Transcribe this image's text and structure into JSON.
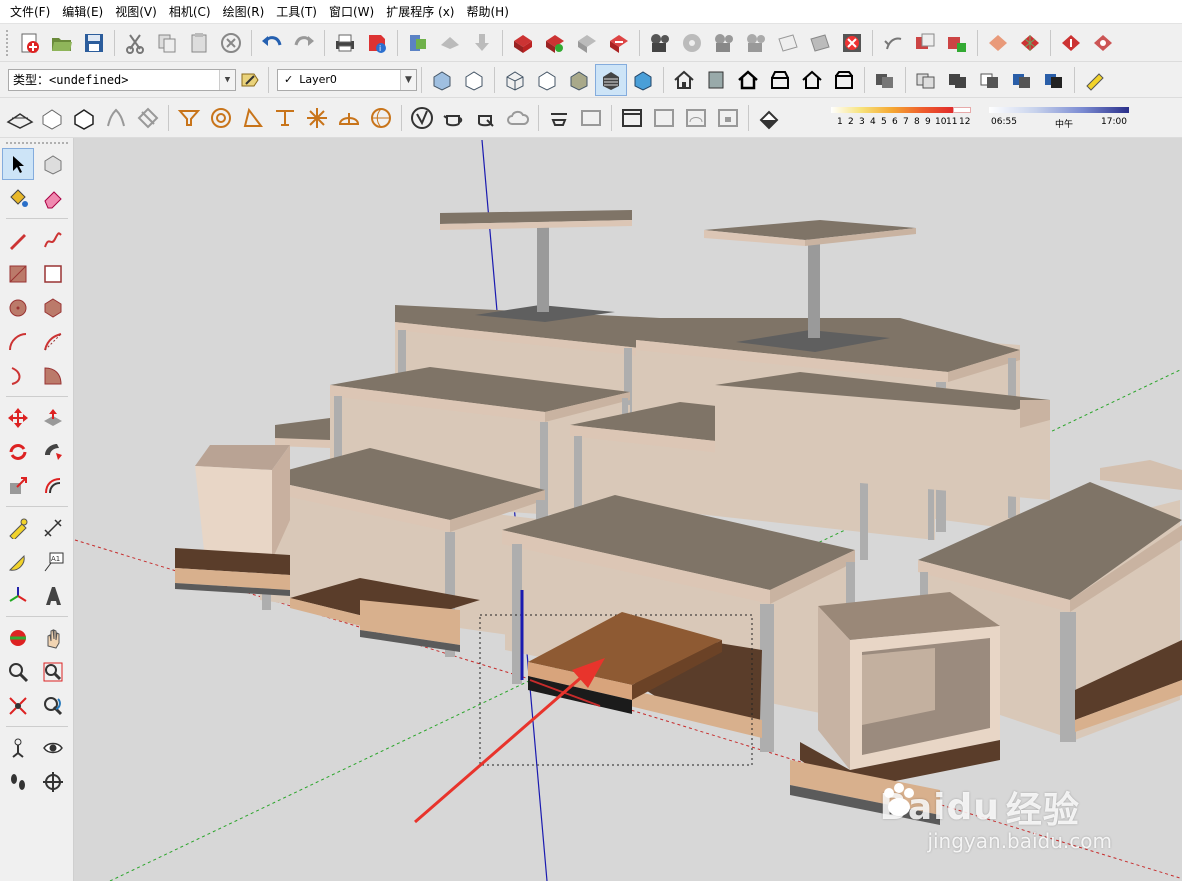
{
  "menu": [
    "文件(F)",
    "编辑(E)",
    "视图(V)",
    "相机(C)",
    "绘图(R)",
    "工具(T)",
    "窗口(W)",
    "扩展程序 (x)",
    "帮助(H)"
  ],
  "entity_info": {
    "label": "类型：",
    "value": "<undefined>"
  },
  "layer": {
    "checked": "✓",
    "name": "Layer0"
  },
  "shadow": {
    "months": [
      "1",
      "2",
      "3",
      "4",
      "5",
      "6",
      "7",
      "8",
      "9",
      "10",
      "11",
      "12"
    ],
    "time_start": "06:55",
    "time_mid": "中午",
    "time_end": "17:00"
  },
  "watermark": {
    "brand": "Bai",
    "brand2": "du",
    "brand3": "经验",
    "url": "jingyan.baidu.com"
  },
  "colors": {
    "viewport_bg": "#d7d7d7",
    "table_top": "#7f7467",
    "table_edge": "#dcc6b5",
    "leg": "#aeaeae",
    "panel": "#d9c8b8",
    "floor_wood": "#8e5a33",
    "arrow": "#e8342c",
    "axis_red": "#c62b2b",
    "axis_green": "#2aa52a",
    "axis_blue": "#1a1ab0"
  }
}
